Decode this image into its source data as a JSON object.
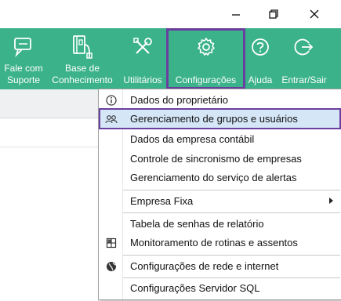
{
  "window_controls": {
    "minimize": "minimize-icon",
    "restore": "restore-icon",
    "close": "close-icon"
  },
  "ribbon": {
    "bg_color": "#3bb28a",
    "highlight_color": "#6a3fa0",
    "buttons": [
      {
        "line1": "Fale com",
        "line2": "Suporte",
        "icon": "chat-icon"
      },
      {
        "line1": "Base de",
        "line2": "Conhecimento",
        "icon": "book-usb-icon"
      },
      {
        "line1": "",
        "line2": "Utilitários",
        "icon": "tools-icon"
      },
      {
        "line1": "",
        "line2": "Configurações",
        "icon": "gear-icon",
        "selected": true
      },
      {
        "line1": "",
        "line2": "Ajuda",
        "icon": "help-icon"
      },
      {
        "line1": "",
        "line2": "Entrar/Sair",
        "icon": "logout-icon"
      }
    ]
  },
  "menu": {
    "items": [
      {
        "label": "Dados do proprietário",
        "icon": "info-icon"
      },
      {
        "label": "Gerenciamento de grupos e usuários",
        "icon": "users-icon",
        "highlighted": true
      },
      {
        "label": "Dados da empresa contábil",
        "icon": ""
      },
      {
        "label": "Controle de sincronismo de empresas",
        "icon": ""
      },
      {
        "label": "Gerenciamento do serviço de alertas",
        "icon": ""
      },
      {
        "label": "Empresa Fixa",
        "icon": "",
        "submenu": true
      },
      {
        "label": "Tabela de senhas de relatório",
        "icon": ""
      },
      {
        "label": "Monitoramento de rotinas e assentos",
        "icon": "monitor-icon"
      },
      {
        "label": "Configurações de rede e internet",
        "icon": "globe-icon"
      },
      {
        "label": "Configurações Servidor SQL",
        "icon": ""
      }
    ]
  }
}
